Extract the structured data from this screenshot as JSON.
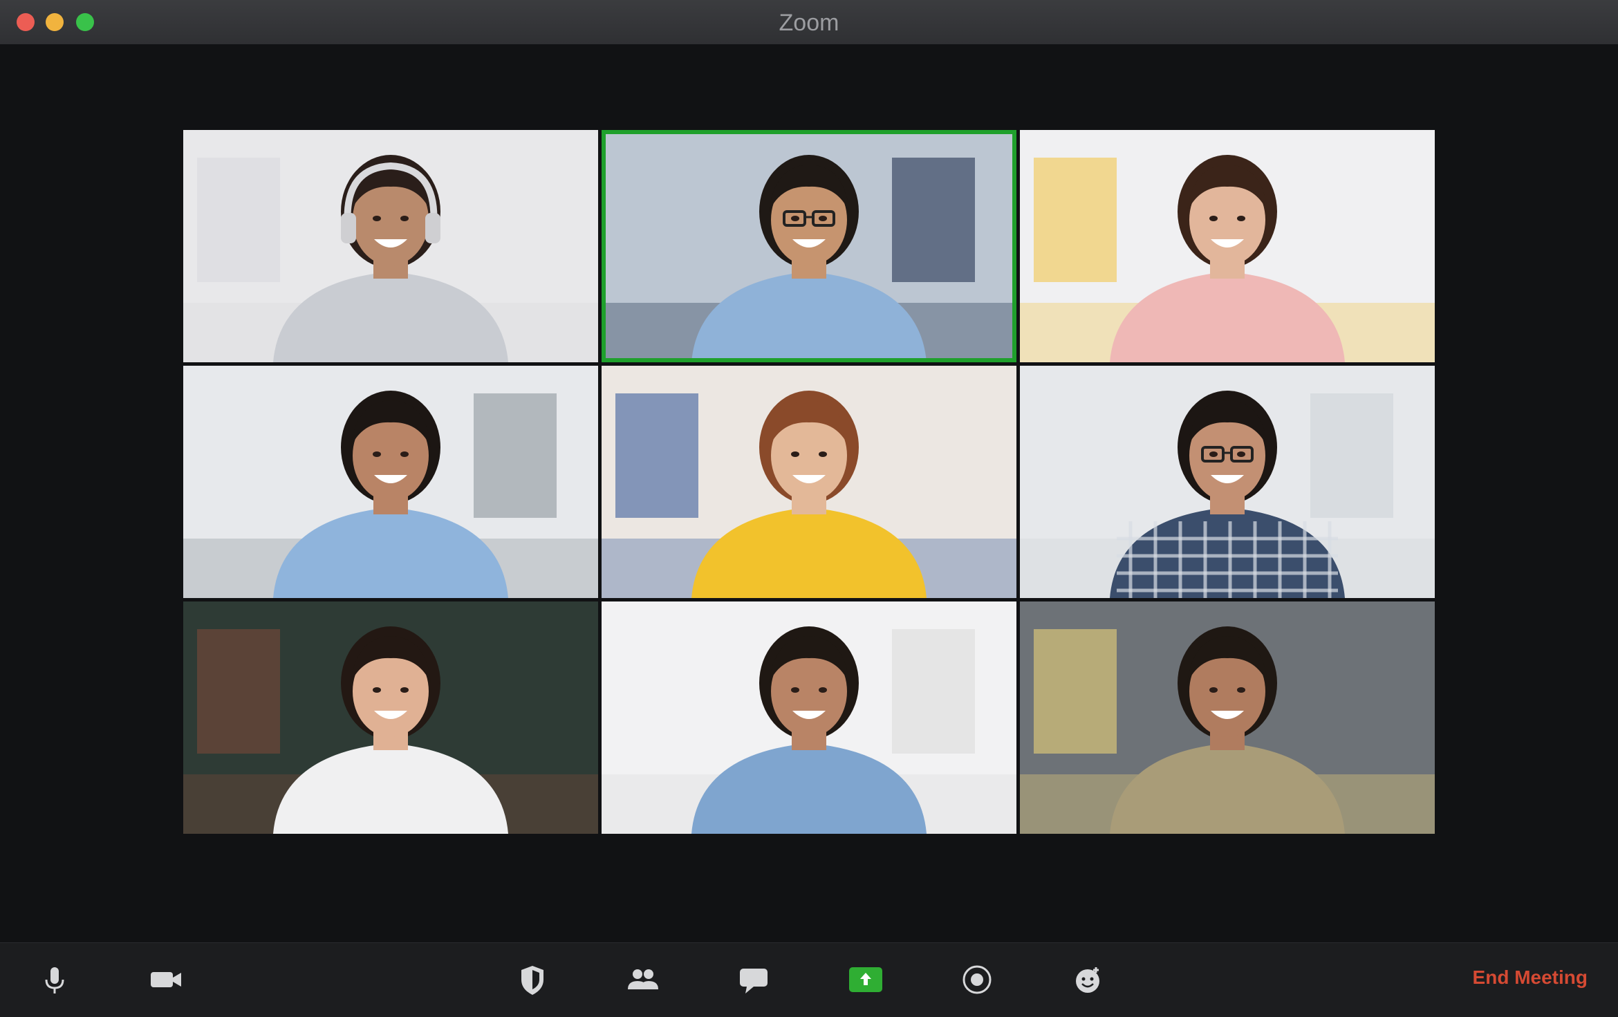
{
  "window": {
    "title": "Zoom"
  },
  "participants": [
    {
      "id": "p1",
      "shirt": "#c9ccd2",
      "skin": "#b98a6c",
      "hair": "#2a1e1a",
      "bg": "#e8e8ea",
      "accent": "#d9d9de",
      "headphones": true
    },
    {
      "id": "p2",
      "shirt": "#8fb2d8",
      "skin": "#c6946f",
      "hair": "#1f1915",
      "bg": "#bcc6d2",
      "accent": "#263654",
      "glasses": true,
      "active": true
    },
    {
      "id": "p3",
      "shirt": "#efb8b6",
      "skin": "#e2b69b",
      "hair": "#3b2419",
      "bg": "#f0f0f2",
      "accent": "#f1c64f"
    },
    {
      "id": "p4",
      "shirt": "#8fb4dc",
      "skin": "#b98466",
      "hair": "#1c1613",
      "bg": "#e7e9ec",
      "accent": "#8f989e"
    },
    {
      "id": "p5",
      "shirt": "#f2c22c",
      "skin": "#e3b898",
      "hair": "#8a4a2a",
      "bg": "#ece7e2",
      "accent": "#3d5f9c"
    },
    {
      "id": "p6",
      "shirt": "#3b4e6c",
      "skin": "#c39073",
      "hair": "#1c1613",
      "bg": "#e6e8eb",
      "accent": "#cfd3d8",
      "glasses": true,
      "plaid": true
    },
    {
      "id": "p7",
      "shirt": "#f0f0f1",
      "skin": "#e0b194",
      "hair": "#231813",
      "bg": "#2e3b35",
      "accent": "#7a4a38"
    },
    {
      "id": "p8",
      "shirt": "#7fa5cf",
      "skin": "#b98466",
      "hair": "#1f1813",
      "bg": "#f2f2f3",
      "accent": "#dcdcdc"
    },
    {
      "id": "p9",
      "shirt": "#a99c78",
      "skin": "#b07c5f",
      "hair": "#1f1813",
      "bg": "#6d7277",
      "accent": "#ead27a"
    }
  ],
  "toolbar": {
    "left": [
      {
        "name": "mute-button",
        "icon": "microphone-icon"
      },
      {
        "name": "stop-video-button",
        "icon": "video-camera-icon"
      }
    ],
    "center": [
      {
        "name": "security-button",
        "icon": "shield-icon"
      },
      {
        "name": "participants-button",
        "icon": "people-icon"
      },
      {
        "name": "chat-button",
        "icon": "chat-bubble-icon"
      },
      {
        "name": "share-screen-button",
        "icon": "share-screen-icon",
        "color": "#2fae33"
      },
      {
        "name": "record-button",
        "icon": "record-icon"
      },
      {
        "name": "reactions-button",
        "icon": "reactions-icon"
      }
    ],
    "end_label": "End Meeting",
    "end_color": "#d54a33"
  }
}
